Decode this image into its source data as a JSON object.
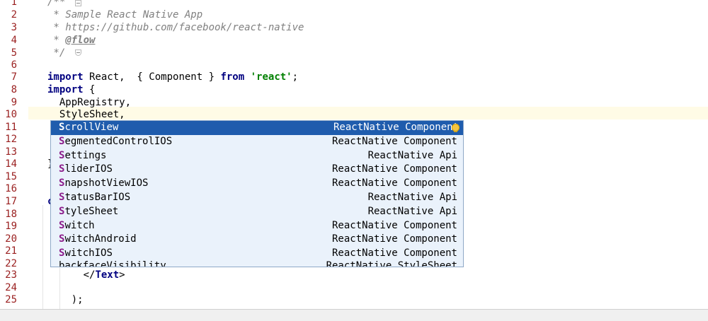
{
  "gutter": {
    "line_numbers": [
      "1",
      "2",
      "3",
      "4",
      "5",
      "6",
      "7",
      "8",
      "9",
      "10",
      "11",
      "12",
      "13",
      "14",
      "15",
      "16",
      "17",
      "18",
      "19",
      "20",
      "21",
      "22",
      "23",
      "24",
      "25"
    ]
  },
  "code": {
    "l1": "/**",
    "l2": " * Sample React Native App",
    "l3": " * https://github.com/facebook/react-native",
    "l4_prefix": " * ",
    "l4_tag": "@flow",
    "l5": " */",
    "l7_import": "import",
    "l7_mid": " React,  { Component } ",
    "l7_from": "from",
    "l7_space": " ",
    "l7_str": "'react'",
    "l7_end": ";",
    "l8_import": "import",
    "l8_rest": " {",
    "l9": "  AppRegistry,",
    "l10": "  StyleSheet,",
    "l11": "  ",
    "l14": "}",
    "l17": "c",
    "l23_open": "      </",
    "l23_tag": "Text",
    "l23_close": ">",
    "l25": "    );"
  },
  "completion": {
    "items": [
      {
        "prefix": "S",
        "name": "crollView",
        "type": "ReactNative Component",
        "selected": true
      },
      {
        "prefix": "S",
        "name": "egmentedControlIOS",
        "type": "ReactNative Component"
      },
      {
        "prefix": "S",
        "name": "ettings",
        "type": "ReactNative Api"
      },
      {
        "prefix": "S",
        "name": "liderIOS",
        "type": "ReactNative Component"
      },
      {
        "prefix": "S",
        "name": "napshotViewIOS",
        "type": "ReactNative Component"
      },
      {
        "prefix": "S",
        "name": "tatusBarIOS",
        "type": "ReactNative Api"
      },
      {
        "prefix": "S",
        "name": "tyleSheet",
        "type": "ReactNative Api"
      },
      {
        "prefix": "S",
        "name": "witch",
        "type": "ReactNative Component"
      },
      {
        "prefix": "S",
        "name": "witchAndroid",
        "type": "ReactNative Component"
      },
      {
        "prefix": "S",
        "name": "witchIOS",
        "type": "ReactNative Component"
      },
      {
        "prefix": "",
        "name": "backfaceVisibility",
        "type": "ReactNative StyleSheet"
      }
    ]
  },
  "colors": {
    "selection": "#1f5cad",
    "popup_bg": "#eaf2fb",
    "keyword": "#000080",
    "string": "#008000",
    "comment": "#808080",
    "line_number": "#9a1f1f",
    "match_highlight": "#8b1d8b"
  },
  "icons": {
    "intention": "lightbulb-icon",
    "fold": "fold-marker-icon"
  }
}
